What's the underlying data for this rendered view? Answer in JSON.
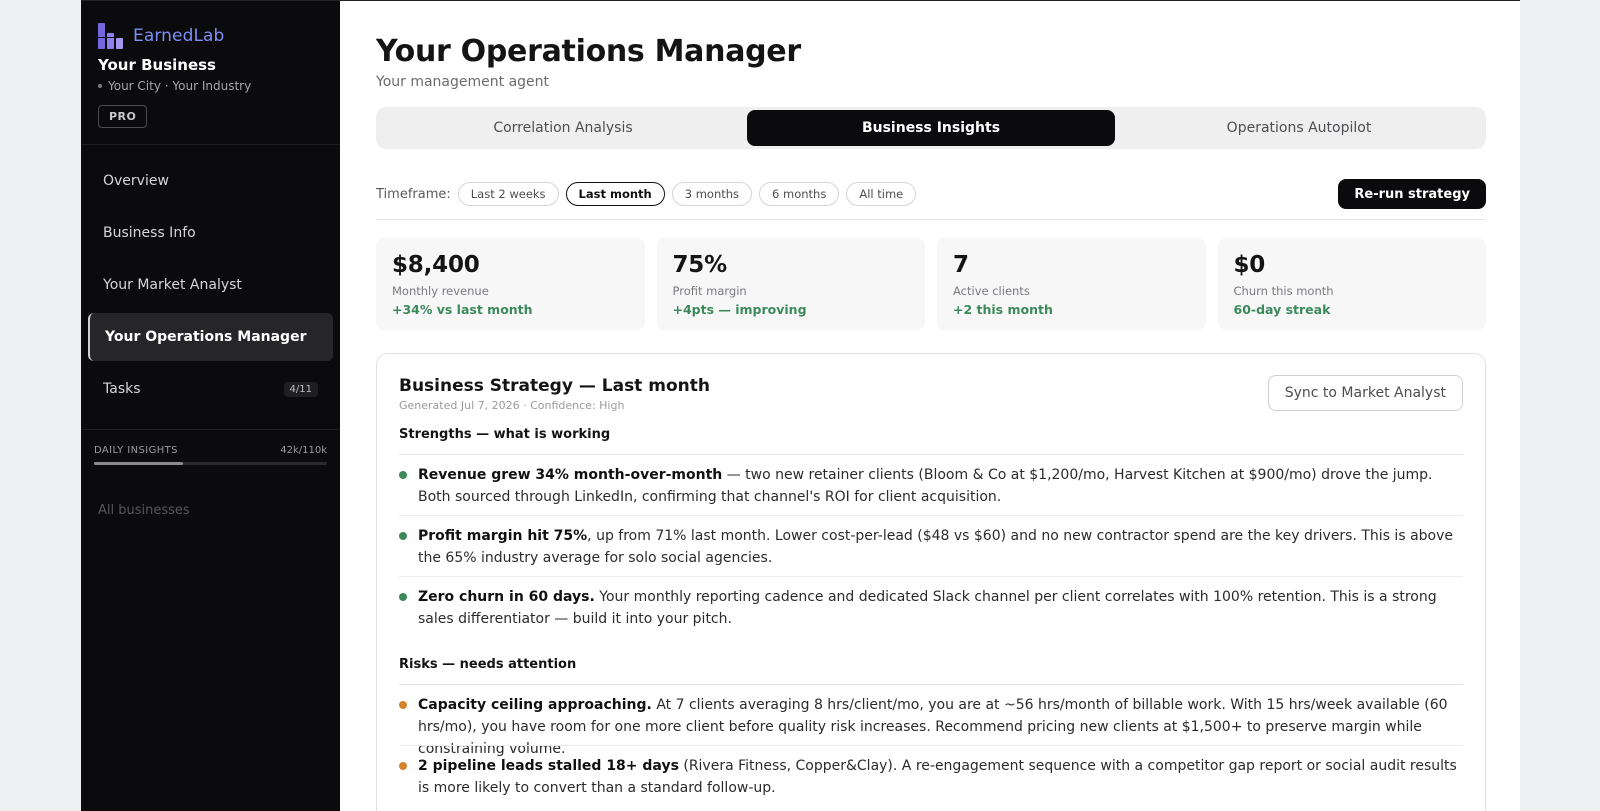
{
  "brand": {
    "name": "EarnedLab"
  },
  "business": {
    "name": "Your Business",
    "location": "Your City · Your Industry",
    "plan": "PRO"
  },
  "nav": {
    "items": [
      {
        "label": "Overview"
      },
      {
        "label": "Business Info"
      },
      {
        "label": "Your Market Analyst"
      },
      {
        "label": "Your Operations Manager",
        "active": true
      },
      {
        "label": "Tasks",
        "badge": "4/11"
      }
    ]
  },
  "daily_insights": {
    "label": "DAILY INSIGHTS",
    "count": "42k/110k",
    "progress": 0.38
  },
  "all_businesses": "All businesses",
  "page": {
    "title": "Your Operations Manager",
    "subtitle": "Your management agent"
  },
  "tabs": [
    {
      "label": "Correlation Analysis"
    },
    {
      "label": "Business Insights",
      "active": true
    },
    {
      "label": "Operations Autopilot"
    }
  ],
  "timeframe": {
    "label": "Timeframe:",
    "options": [
      "Last 2 weeks",
      "Last month",
      "3 months",
      "6 months",
      "All time"
    ],
    "selected": "Last month",
    "rerun_label": "Re-run strategy"
  },
  "stats": [
    {
      "value": "$8,400",
      "label": "Monthly revenue",
      "delta": "+34% vs last month"
    },
    {
      "value": "75%",
      "label": "Profit margin",
      "delta": "+4pts — improving"
    },
    {
      "value": "7",
      "label": "Active clients",
      "delta": "+2 this month"
    },
    {
      "value": "$0",
      "label": "Churn this month",
      "delta": "60-day streak"
    }
  ],
  "strategy": {
    "title": "Business Strategy — Last month",
    "meta": "Generated Jul 7, 2026 · Confidence: High",
    "sync_label": "Sync to Market Analyst",
    "strengths_heading": "Strengths — what is working",
    "strengths": [
      {
        "bold": "Revenue grew 34% month-over-month",
        "text": " — two new retainer clients (Bloom & Co at $1,200/mo, Harvest Kitchen at $900/mo) drove the jump. Both sourced through LinkedIn, confirming that channel's ROI for client acquisition."
      },
      {
        "bold": "Profit margin hit 75%",
        "text": ", up from 71% last month. Lower cost-per-lead ($48 vs $60) and no new contractor spend are the key drivers. This is above the 65% industry average for solo social agencies."
      },
      {
        "bold": "Zero churn in 60 days.",
        "text": " Your monthly reporting cadence and dedicated Slack channel per client correlates with 100% retention. This is a strong sales differentiator — build it into your pitch."
      }
    ],
    "risks_heading": "Risks — needs attention",
    "risks": [
      {
        "bold": "Capacity ceiling approaching.",
        "text": " At 7 clients averaging 8 hrs/client/mo, you are at ~56 hrs/month of billable work. With 15 hrs/week available (60 hrs/mo), you have room for one more client before quality risk increases. Recommend pricing new clients at $1,500+ to preserve margin while constraining volume."
      },
      {
        "bold": "2 pipeline leads stalled 18+ days",
        "text": " (Rivera Fitness, Copper&Clay). A re-engagement sequence with a competitor gap report or social audit results is more likely to convert than a standard follow-up."
      }
    ]
  },
  "colors": {
    "positive": "#3c8a5b",
    "risk": "#d4832c",
    "accent": "#7d8ff5"
  }
}
